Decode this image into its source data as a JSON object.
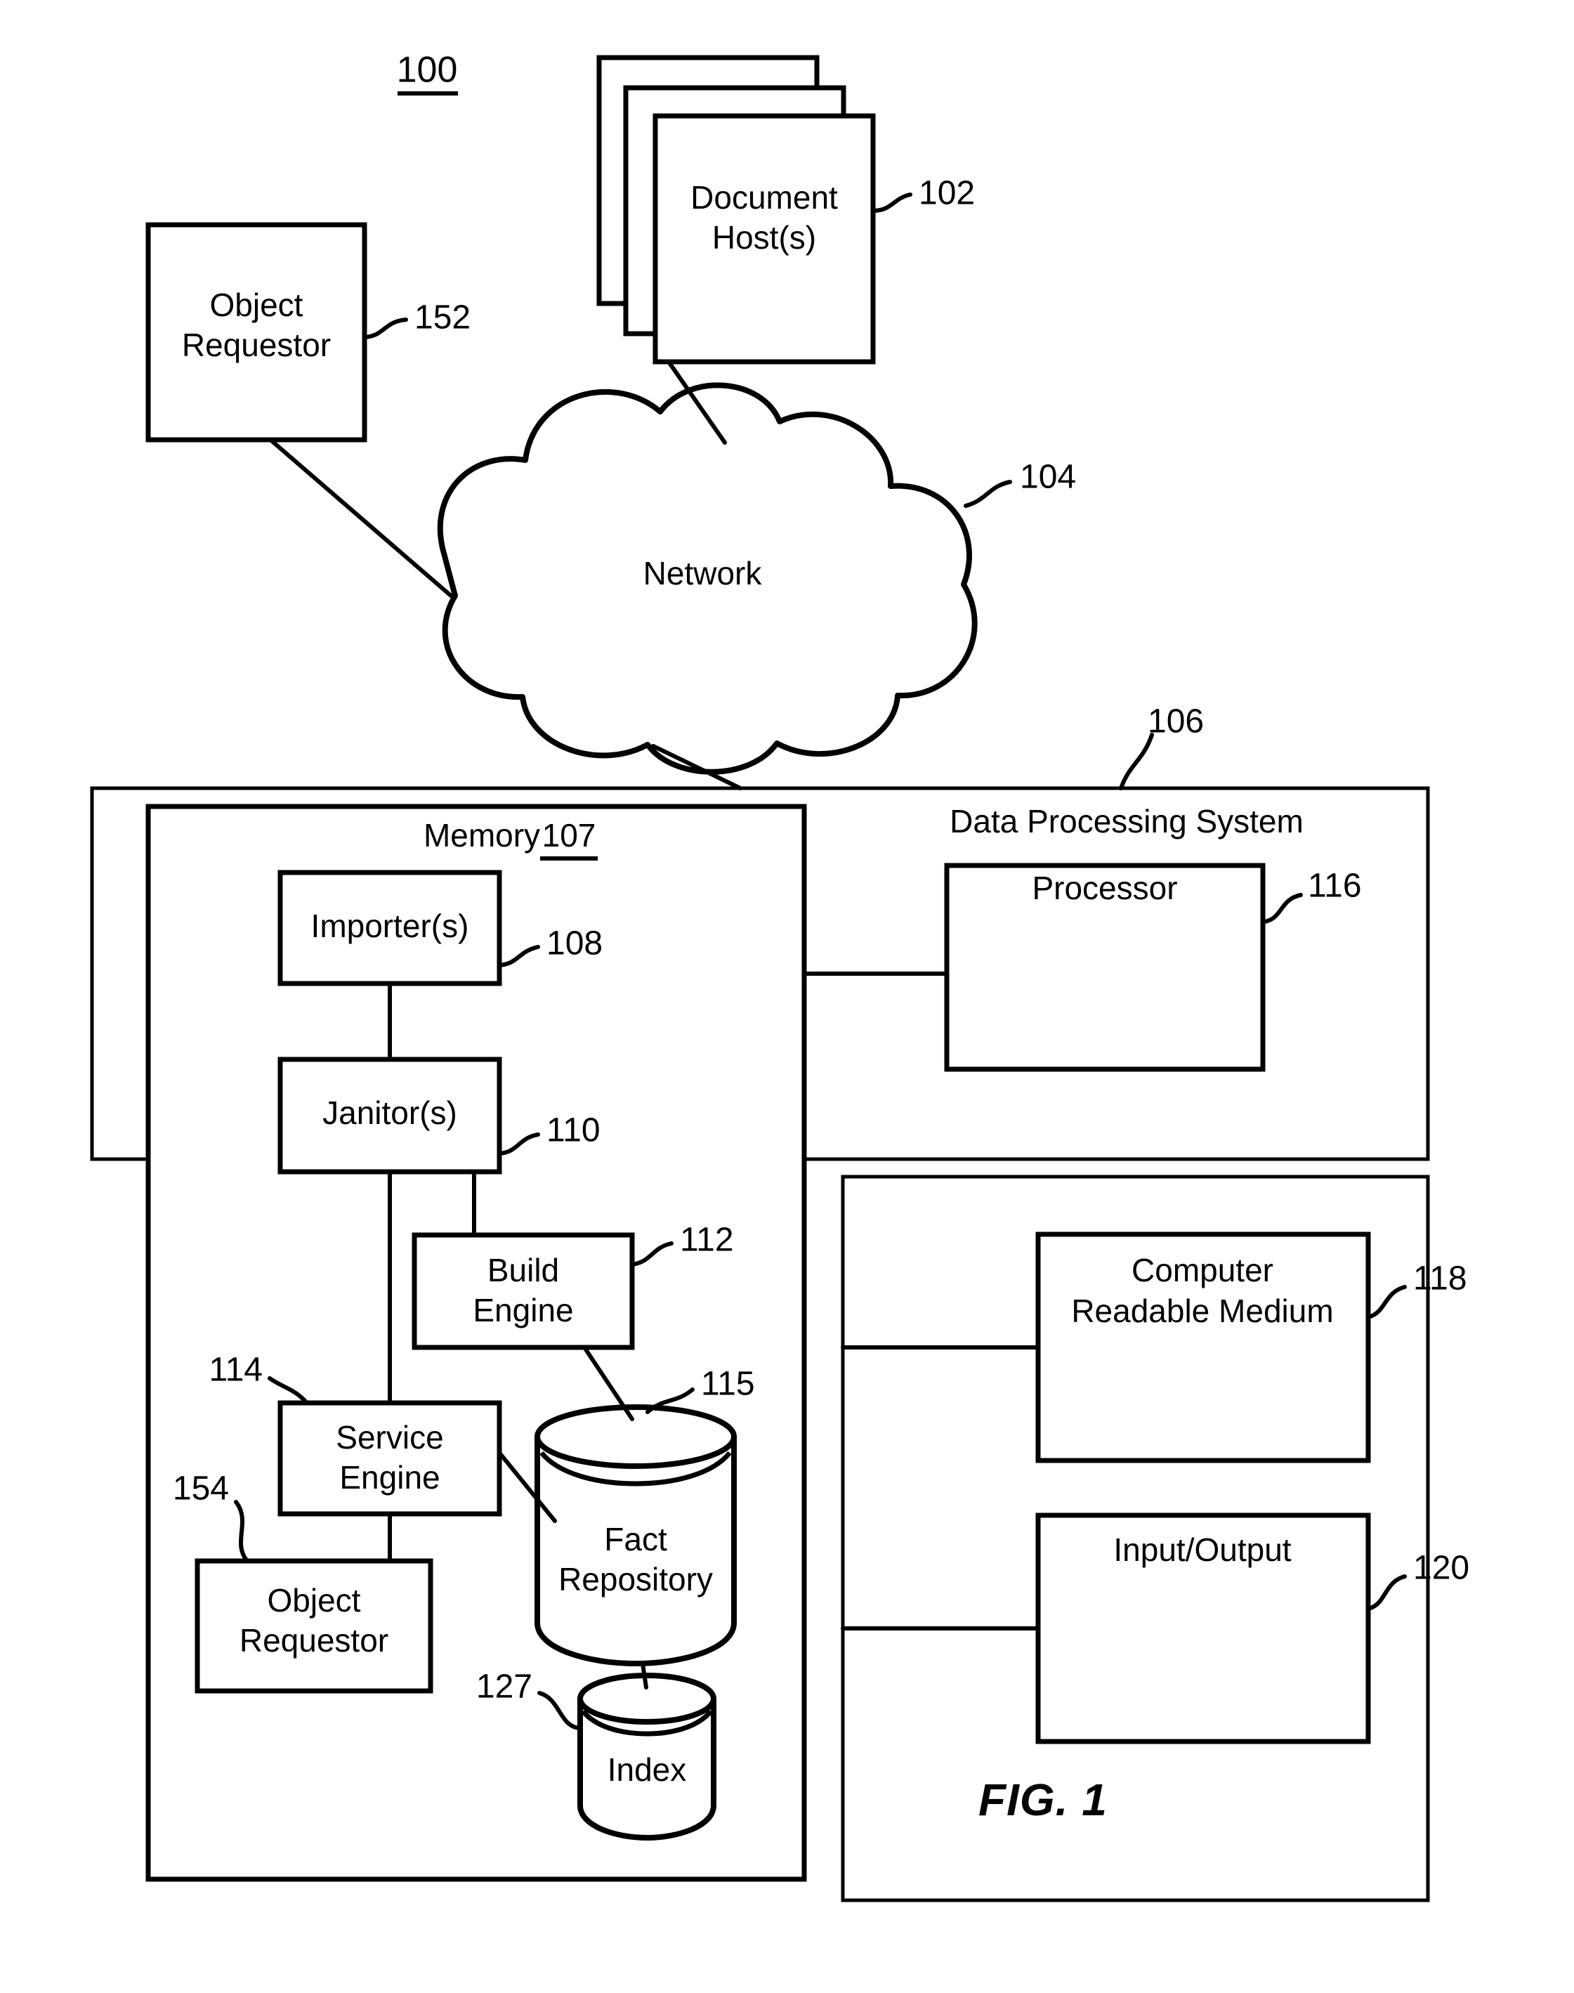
{
  "figure": {
    "caption": "FIG. 1",
    "system_number": "100"
  },
  "nodes": {
    "document_hosts": {
      "label_line1": "Document",
      "label_line2": "Host(s)",
      "ref": "102"
    },
    "object_requestor_external": {
      "label_line1": "Object",
      "label_line2": "Requestor",
      "ref": "152"
    },
    "network": {
      "label": "Network",
      "ref": "104"
    },
    "data_processing_system": {
      "label": "Data Processing System",
      "ref": "106"
    },
    "memory": {
      "label": "Memory",
      "ref": "107"
    },
    "importers": {
      "label": "Importer(s)",
      "ref": "108"
    },
    "janitors": {
      "label": "Janitor(s)",
      "ref": "110"
    },
    "build_engine": {
      "label_line1": "Build",
      "label_line2": "Engine",
      "ref": "112"
    },
    "service_engine": {
      "label_line1": "Service",
      "label_line2": "Engine",
      "ref": "114"
    },
    "fact_repository": {
      "label_line1": "Fact",
      "label_line2": "Repository",
      "ref": "115"
    },
    "object_requestor_internal": {
      "label_line1": "Object",
      "label_line2": "Requestor",
      "ref": "154"
    },
    "index": {
      "label": "Index",
      "ref": "127"
    },
    "processor": {
      "label": "Processor",
      "ref": "116"
    },
    "computer_readable_medium": {
      "label_line1": "Computer",
      "label_line2": "Readable Medium",
      "ref": "118"
    },
    "input_output": {
      "label": "Input/Output",
      "ref": "120"
    }
  },
  "colors": {
    "ink": "#000000",
    "paper": "#ffffff"
  }
}
